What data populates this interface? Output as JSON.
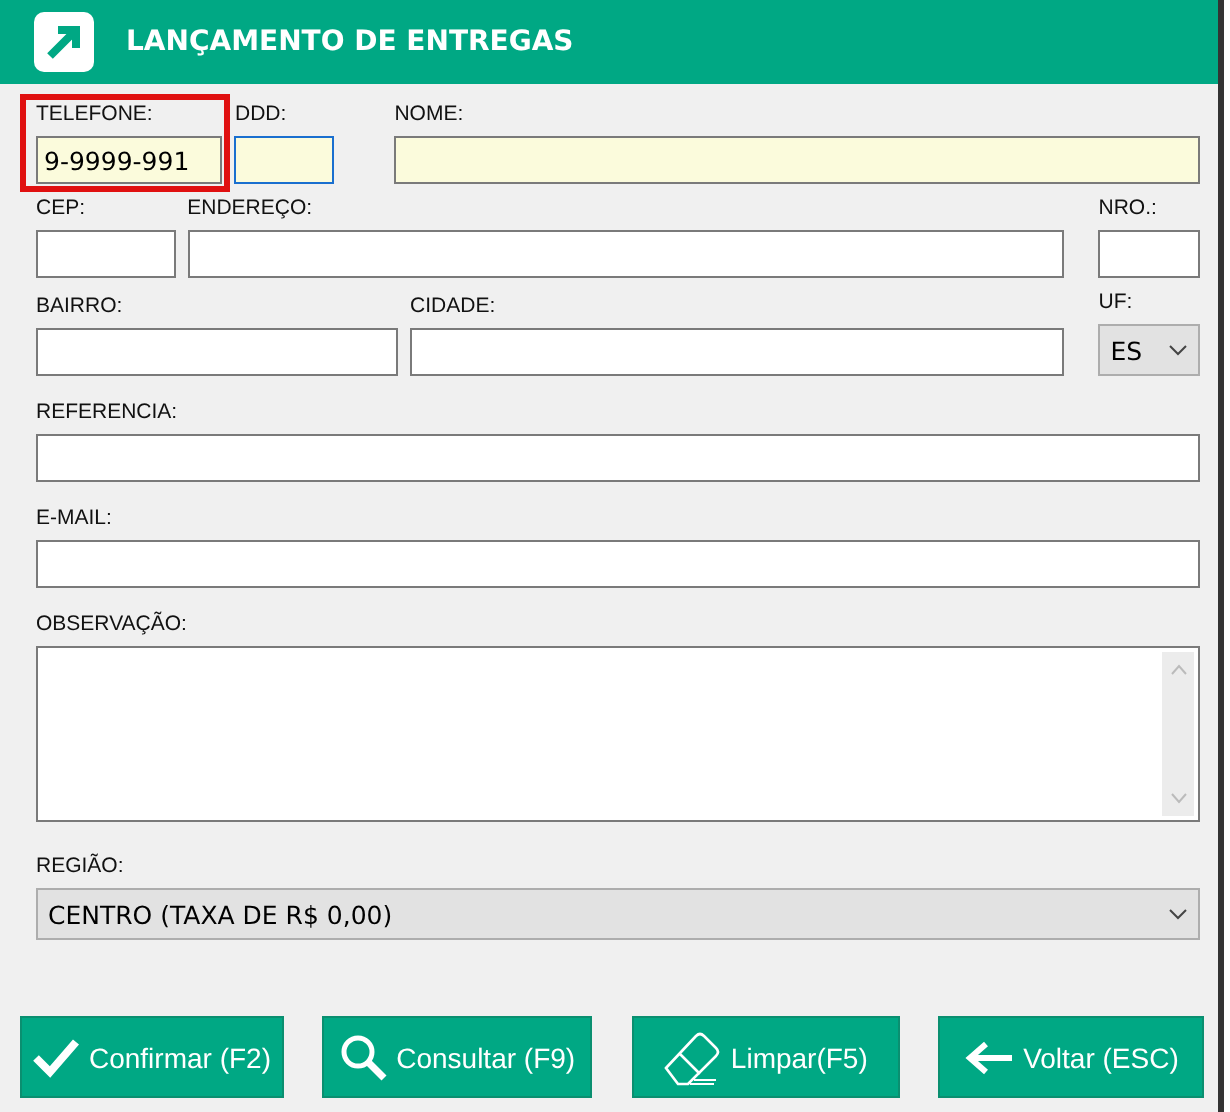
{
  "window": {
    "title": "LANÇAMENTO DE ENTREGAS"
  },
  "rows": [
    [
      {
        "kind": "text",
        "label": "TELEFONE:",
        "value": "9-9999-991",
        "required": true,
        "focused": false,
        "outlined": true
      },
      {
        "kind": "text",
        "label": "DDD:",
        "required": true,
        "focused": true,
        "outlined": false
      },
      {
        "kind": "text",
        "label": "NOME:",
        "required": true,
        "focused": false,
        "outlined": false
      }
    ],
    [
      {
        "kind": "text",
        "label": "CEP:",
        "required": false,
        "focused": false,
        "outlined": false
      },
      {
        "kind": "text",
        "label": "ENDEREÇO:",
        "required": false,
        "focused": false,
        "outlined": false
      },
      {
        "kind": "text",
        "label": "NRO.:",
        "required": false,
        "focused": false,
        "outlined": false
      }
    ],
    [
      {
        "kind": "text",
        "label": "BAIRRO:",
        "required": false,
        "focused": false,
        "outlined": false
      },
      {
        "kind": "text",
        "label": "CIDADE:",
        "required": false,
        "focused": false,
        "outlined": false
      },
      {
        "kind": "select",
        "label": "UF:",
        "value": "ES",
        "required": false,
        "focused": false,
        "outlined": false
      }
    ],
    [
      {
        "kind": "text",
        "label": "REFERENCIA:",
        "required": false,
        "focused": false,
        "outlined": false
      }
    ],
    [
      {
        "kind": "text",
        "label": "E-MAIL:",
        "required": false,
        "focused": false,
        "outlined": false
      }
    ],
    [
      {
        "kind": "textarea",
        "label": "OBSERVAÇÃO:",
        "required": false,
        "focused": false,
        "outlined": false
      }
    ],
    [
      {
        "kind": "select",
        "label": "REGIÃO:",
        "value": "CENTRO (TAXA DE R$ 0,00)",
        "required": false,
        "focused": false,
        "outlined": false
      }
    ]
  ],
  "buttons": [
    {
      "kind": "confirm",
      "label": "Confirmar (F2)"
    },
    {
      "kind": "search",
      "label": "Consultar (F9)"
    },
    {
      "kind": "clear",
      "label": "Limpar(F5)"
    },
    {
      "kind": "back",
      "label": "Voltar (ESC)"
    }
  ]
}
